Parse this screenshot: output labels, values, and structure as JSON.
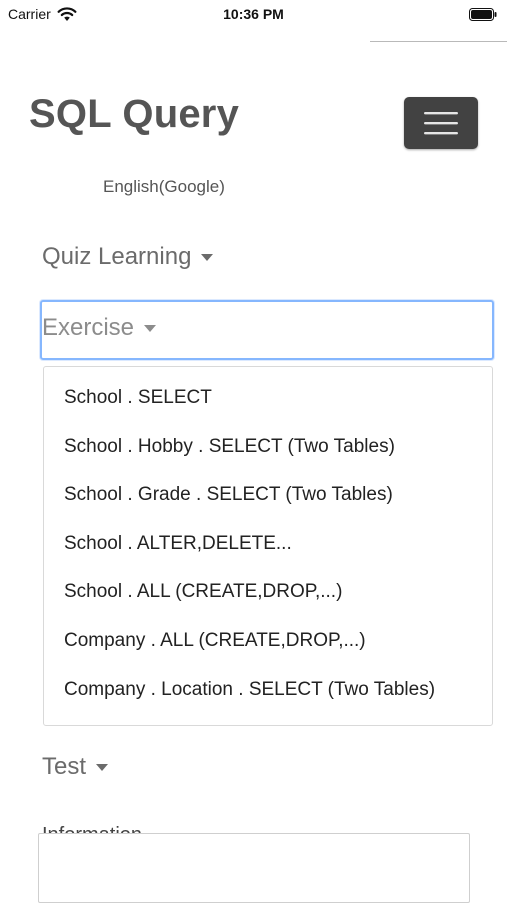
{
  "status_bar": {
    "carrier": "Carrier",
    "time": "10:36 PM"
  },
  "header": {
    "title": "SQL Query",
    "menu_icon": "hamburger-icon",
    "language": "English(Google)"
  },
  "nav": {
    "quiz_label": "Quiz Learning",
    "exercise_label": "Exercise",
    "test_label": "Test",
    "information_label": "Information"
  },
  "exercise_menu": {
    "items": [
      "School . SELECT",
      "School . Hobby . SELECT (Two Tables)",
      "School . Grade . SELECT (Two Tables)",
      "School . ALTER,DELETE...",
      "School . ALL (CREATE,DROP,...)",
      "Company . ALL (CREATE,DROP,...)",
      "Company . Location . SELECT (Two Tables)"
    ]
  },
  "colors": {
    "menu_button_bg": "#424242",
    "focus_border": "#86b7fe",
    "brand_text": "#555555"
  }
}
